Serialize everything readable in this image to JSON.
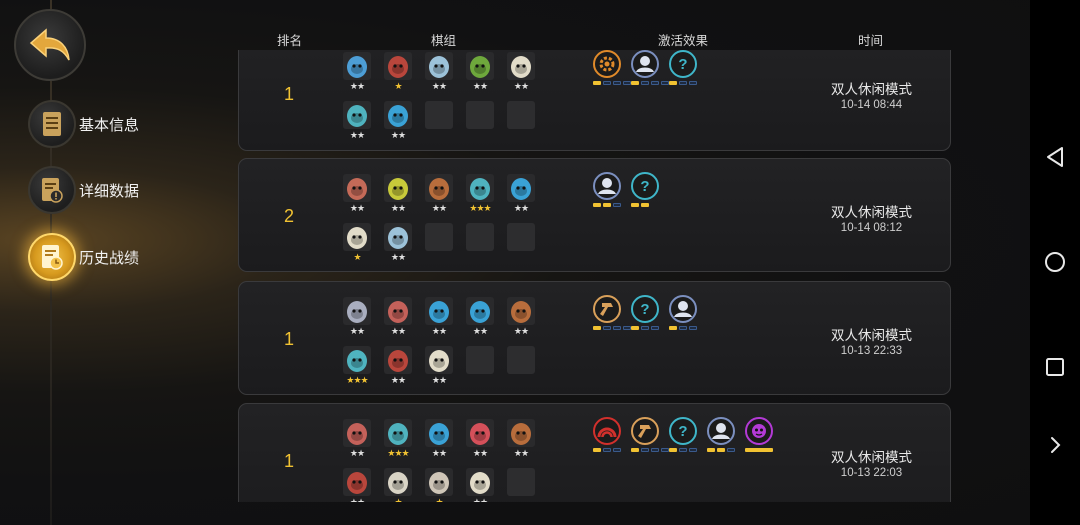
{
  "sidebar": {
    "items": [
      {
        "label": "基本信息",
        "icon": "document-icon",
        "active": false
      },
      {
        "label": "详细数据",
        "icon": "stats-document-icon",
        "active": false
      },
      {
        "label": "历史战绩",
        "icon": "history-document-icon",
        "active": true
      }
    ]
  },
  "headers": {
    "rank": "排名",
    "pieces": "棋组",
    "effects": "激活效果",
    "time": "时间"
  },
  "matches": [
    {
      "rank": "1",
      "mode": "双人休闲模式",
      "time": "10-14 08:44",
      "pieces": [
        {
          "c": "#4d9ed6",
          "s": "★★",
          "g": false
        },
        {
          "c": "#b9463c",
          "s": "★",
          "g": true
        },
        {
          "c": "#9cc2d9",
          "s": "★★",
          "g": false
        },
        {
          "c": "#6ea83c",
          "s": "★★",
          "g": false
        },
        {
          "c": "#e2dcc9",
          "s": "★★",
          "g": false
        },
        {
          "c": "#4fb3bf",
          "s": "★★",
          "g": false
        },
        {
          "c": "#3aa2d6",
          "s": "★★",
          "g": false
        },
        {
          "c": "",
          "s": "",
          "g": false
        },
        {
          "c": "",
          "s": "",
          "g": false
        },
        {
          "c": "",
          "s": "",
          "g": false
        }
      ],
      "effects": [
        {
          "icon": "gear-icon",
          "color": "#e08a2a",
          "bars": [
            1,
            0,
            0,
            0
          ]
        },
        {
          "icon": "avatar-icon",
          "color": "#7b8fbf",
          "bars": [
            1,
            0,
            0,
            0
          ]
        },
        {
          "icon": "question-icon",
          "color": "#3fb6c9",
          "bars": [
            1,
            0,
            0
          ]
        }
      ]
    },
    {
      "rank": "2",
      "mode": "双人休闲模式",
      "time": "10-14 08:12",
      "pieces": [
        {
          "c": "#c46a58",
          "s": "★★",
          "g": false
        },
        {
          "c": "#c7c93a",
          "s": "★★",
          "g": false
        },
        {
          "c": "#b86d3c",
          "s": "★★",
          "g": false
        },
        {
          "c": "#4fb3bf",
          "s": "★★★",
          "g": true
        },
        {
          "c": "#3aa2d6",
          "s": "★★",
          "g": false
        },
        {
          "c": "#e2dcc9",
          "s": "★",
          "g": true
        },
        {
          "c": "#9cc2d9",
          "s": "★★",
          "g": false
        },
        {
          "c": "",
          "s": "",
          "g": false
        },
        {
          "c": "",
          "s": "",
          "g": false
        },
        {
          "c": "",
          "s": "",
          "g": false
        }
      ],
      "effects": [
        {
          "icon": "avatar-icon",
          "color": "#7b8fbf",
          "bars": [
            1,
            1,
            0
          ]
        },
        {
          "icon": "question-icon",
          "color": "#3fb6c9",
          "bars": [
            1,
            1
          ]
        }
      ]
    },
    {
      "rank": "1",
      "mode": "双人休闲模式",
      "time": "10-13 22:33",
      "pieces": [
        {
          "c": "#a9aebf",
          "s": "★★",
          "g": false
        },
        {
          "c": "#c4615a",
          "s": "★★",
          "g": false
        },
        {
          "c": "#3aa2d6",
          "s": "★★",
          "g": false
        },
        {
          "c": "#3aa2d6",
          "s": "★★",
          "g": false
        },
        {
          "c": "#b86d3c",
          "s": "★★",
          "g": false
        },
        {
          "c": "#4fb3bf",
          "s": "★★★",
          "g": true
        },
        {
          "c": "#b9463c",
          "s": "★★",
          "g": false
        },
        {
          "c": "#e2dcc9",
          "s": "★★",
          "g": false
        },
        {
          "c": "",
          "s": "",
          "g": false
        },
        {
          "c": "",
          "s": "",
          "g": false
        }
      ],
      "effects": [
        {
          "icon": "hammer-icon",
          "color": "#d9a05a",
          "bars": [
            1,
            0,
            0,
            0
          ]
        },
        {
          "icon": "question-icon",
          "color": "#3fb6c9",
          "bars": [
            1,
            0,
            0
          ]
        },
        {
          "icon": "avatar-icon",
          "color": "#7b8fbf",
          "bars": [
            1,
            0,
            0
          ]
        }
      ]
    },
    {
      "rank": "1",
      "mode": "双人休闲模式",
      "time": "10-13 22:03",
      "pieces": [
        {
          "c": "#c4615a",
          "s": "★★",
          "g": false
        },
        {
          "c": "#4fb3bf",
          "s": "★★★",
          "g": true
        },
        {
          "c": "#3aa2d6",
          "s": "★★",
          "g": false
        },
        {
          "c": "#d4505a",
          "s": "★★",
          "g": false
        },
        {
          "c": "#b86d3c",
          "s": "★★",
          "g": false
        },
        {
          "c": "#b9463c",
          "s": "★★",
          "g": false
        },
        {
          "c": "#d9d4c6",
          "s": "★",
          "g": true
        },
        {
          "c": "#cfc6b8",
          "s": "★",
          "g": true
        },
        {
          "c": "#e2dcc9",
          "s": "★★",
          "g": false
        },
        {
          "c": "",
          "s": "",
          "g": false
        }
      ],
      "effects": [
        {
          "icon": "arch-icon",
          "color": "#d2302c",
          "bars": [
            1,
            0,
            0
          ]
        },
        {
          "icon": "hammer-icon",
          "color": "#d9a05a",
          "bars": [
            1,
            0,
            0,
            0
          ]
        },
        {
          "icon": "question-icon",
          "color": "#3fb6c9",
          "bars": [
            1,
            0,
            0
          ]
        },
        {
          "icon": "avatar-icon",
          "color": "#7b8fbf",
          "bars": [
            1,
            1,
            0
          ]
        },
        {
          "icon": "demon-icon",
          "color": "#b33ad6",
          "bars": [
            1
          ]
        }
      ]
    }
  ]
}
